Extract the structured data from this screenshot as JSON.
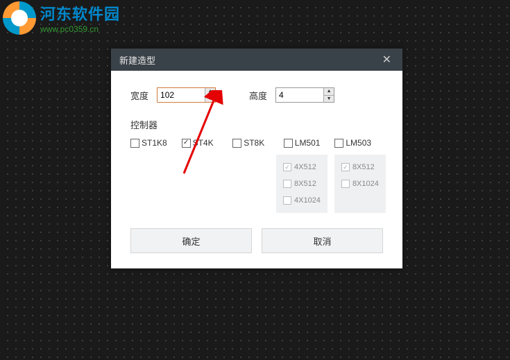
{
  "logo": {
    "title": "河东软件园",
    "url": "www.pc0359.cn"
  },
  "dialog": {
    "title": "新建造型",
    "width_label": "宽度",
    "width_value": "102",
    "height_label": "高度",
    "height_value": "4",
    "controller_label": "控制器",
    "controllers": [
      {
        "name": "ST1K8",
        "checked": false
      },
      {
        "name": "ST4K",
        "checked": true
      },
      {
        "name": "ST8K",
        "checked": false
      },
      {
        "name": "LM501",
        "checked": false
      },
      {
        "name": "LM503",
        "checked": false
      }
    ],
    "sub_panels": [
      {
        "options": [
          {
            "name": "4X512",
            "checked": true
          },
          {
            "name": "8X512",
            "checked": false
          },
          {
            "name": "4X1024",
            "checked": false
          }
        ]
      },
      {
        "options": [
          {
            "name": "8X512",
            "checked": true
          },
          {
            "name": "8X1024",
            "checked": false
          }
        ]
      }
    ],
    "ok_label": "确定",
    "cancel_label": "取消"
  }
}
